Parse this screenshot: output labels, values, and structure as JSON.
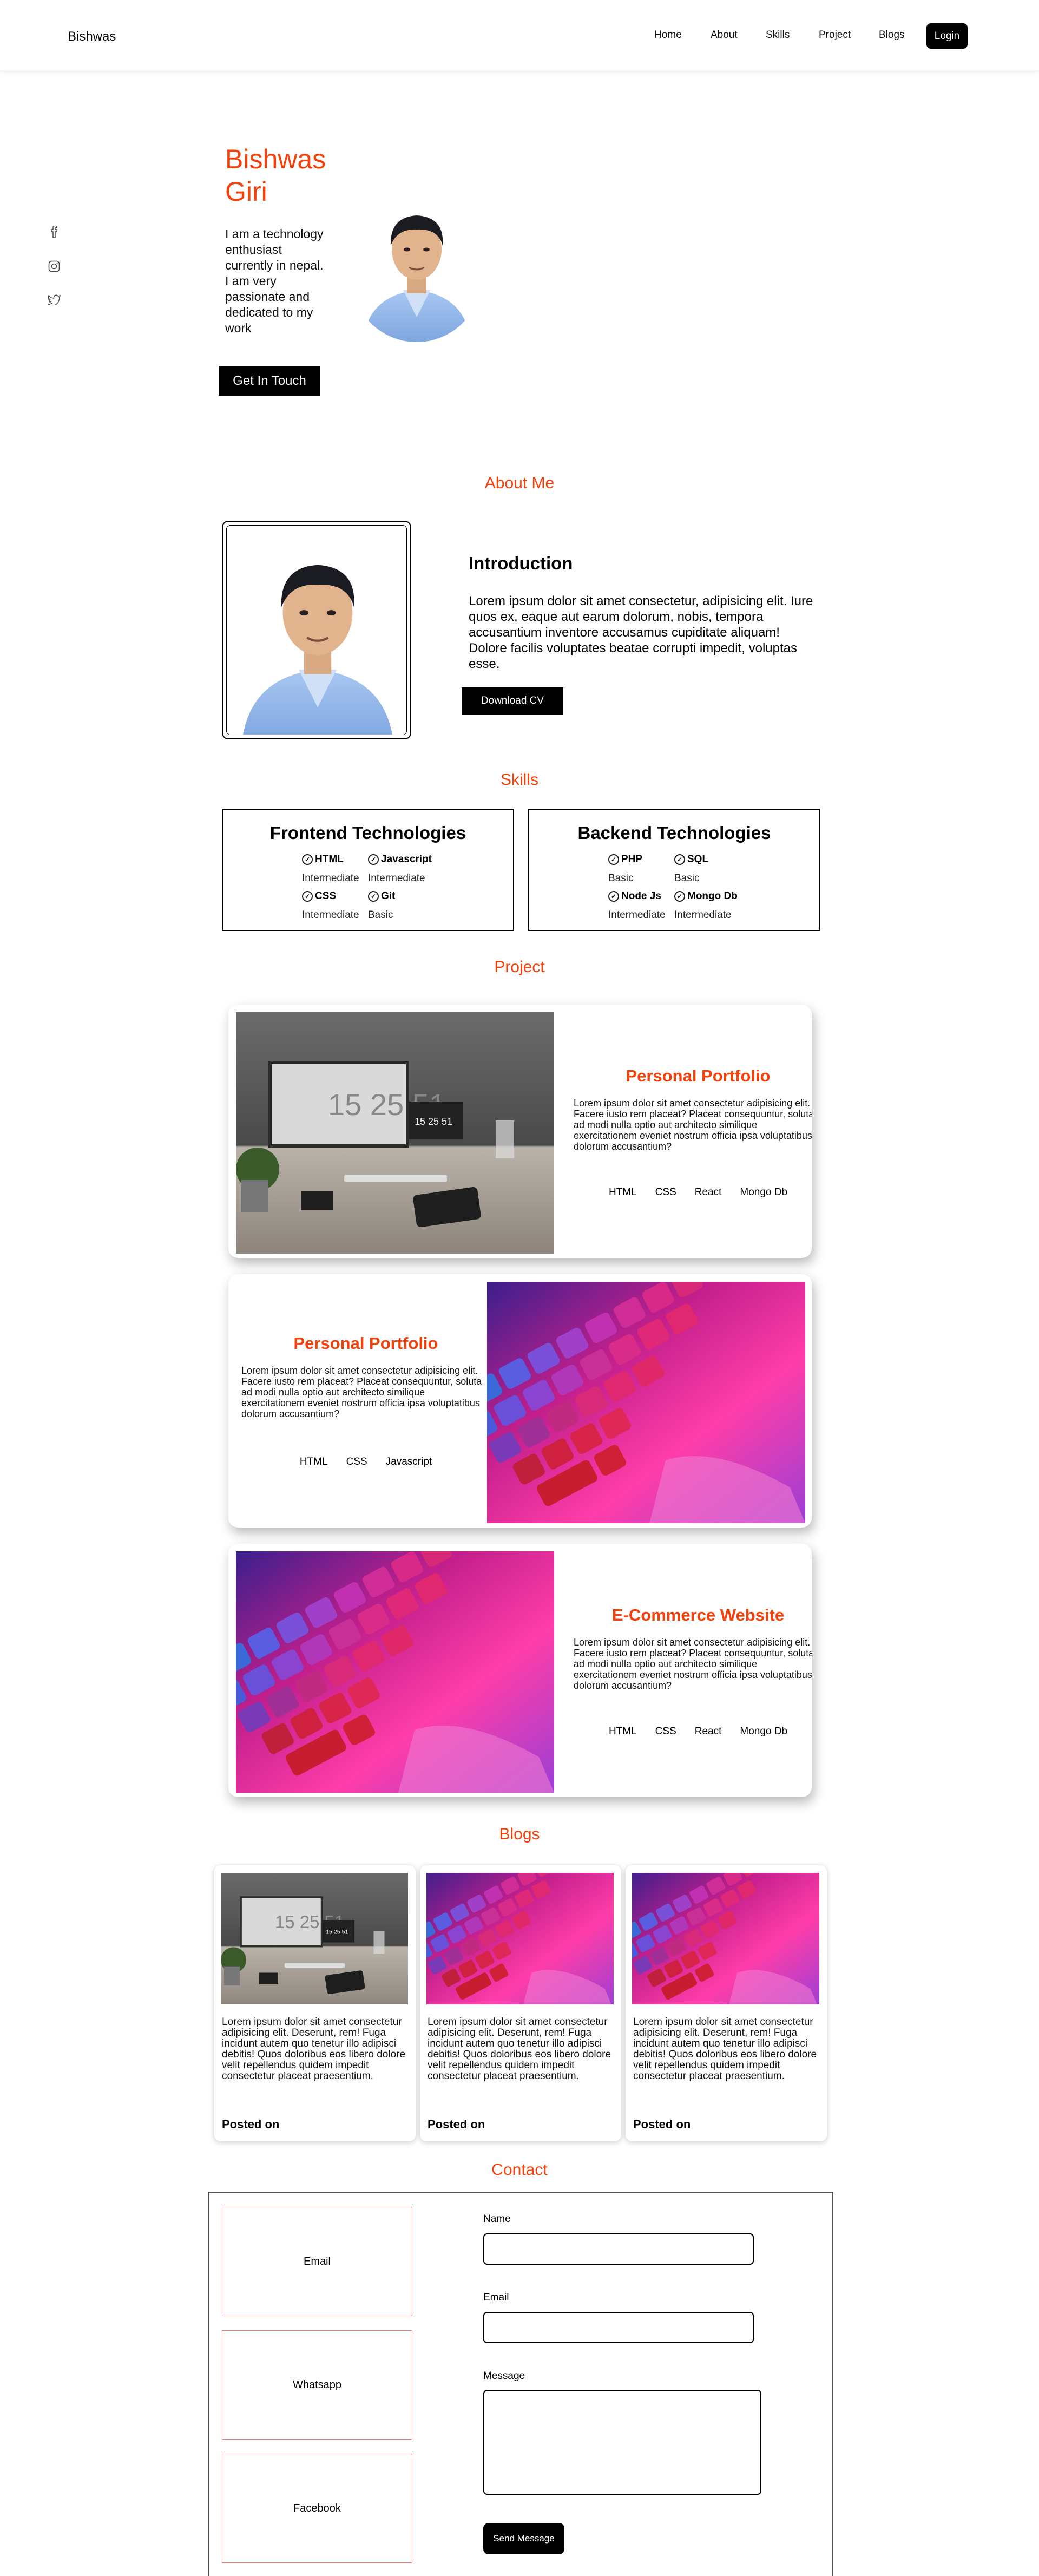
{
  "nav": {
    "brand": "Bishwas",
    "links": [
      "Home",
      "About",
      "Skills",
      "Project",
      "Blogs"
    ],
    "login": "Login"
  },
  "social": [
    "facebook-icon",
    "instagram-icon",
    "twitter-icon"
  ],
  "hero": {
    "name": "Bishwas Giri",
    "bio": "I am a technology enthusiast currently in nepal. I am very passionate and dedicated to my work",
    "button": "Get In Touch"
  },
  "about": {
    "title": "About Me",
    "heading": "Introduction",
    "text": "Lorem ipsum dolor sit amet consectetur, adipisicing elit. Iure quos ex, eaque aut earum dolorum, nobis, tempora accusantium inventore accusamus cupiditate aliquam! Dolore facilis voluptates beatae corrupti impedit, voluptas esse.",
    "button": "Download CV"
  },
  "skills": {
    "title": "Skills",
    "groups": [
      {
        "heading": "Frontend Technologies",
        "items": [
          {
            "name": "HTML",
            "level": "Intermediate"
          },
          {
            "name": "Javascript",
            "level": "Intermediate"
          },
          {
            "name": "CSS",
            "level": "Intermediate"
          },
          {
            "name": "Git",
            "level": "Basic"
          }
        ]
      },
      {
        "heading": "Backend Technologies",
        "items": [
          {
            "name": "PHP",
            "level": "Basic"
          },
          {
            "name": "SQL",
            "level": "Basic"
          },
          {
            "name": "Node Js",
            "level": "Intermediate"
          },
          {
            "name": "Mongo Db",
            "level": "Intermediate"
          }
        ]
      }
    ]
  },
  "projects": {
    "title": "Project",
    "items": [
      {
        "title": "Personal Portfolio",
        "desc": "Lorem ipsum dolor sit amet consectetur adipisicing elit. Facere iusto rem placeat? Placeat consequuntur, soluta ad modi nulla optio aut architecto similique exercitationem eveniet nostrum officia ipsa voluptatibus dolorum accusantium?",
        "tags": [
          "HTML",
          "CSS",
          "React",
          "Mongo Db"
        ]
      },
      {
        "title": "Personal Portfolio",
        "desc": "Lorem ipsum dolor sit amet consectetur adipisicing elit. Facere iusto rem placeat? Placeat consequuntur, soluta ad modi nulla optio aut architecto similique exercitationem eveniet nostrum officia ipsa voluptatibus dolorum accusantium?",
        "tags": [
          "HTML",
          "CSS",
          "Javascript"
        ]
      },
      {
        "title": "E-Commerce Website",
        "desc": "Lorem ipsum dolor sit amet consectetur adipisicing elit. Facere iusto rem placeat? Placeat consequuntur, soluta ad modi nulla optio aut architecto similique exercitationem eveniet nostrum officia ipsa voluptatibus dolorum accusantium?",
        "tags": [
          "HTML",
          "CSS",
          "React",
          "Mongo Db"
        ]
      }
    ]
  },
  "blogs": {
    "title": "Blogs",
    "items": [
      {
        "text": "Lorem ipsum dolor sit amet consectetur adipisicing elit. Deserunt, rem! Fuga incidunt autem quo tenetur illo adipisci debitis! Quos doloribus eos libero dolore velit repellendus quidem impedit consectetur placeat praesentium.",
        "posted": "Posted on"
      },
      {
        "text": "Lorem ipsum dolor sit amet consectetur adipisicing elit. Deserunt, rem! Fuga incidunt autem quo tenetur illo adipisci debitis! Quos doloribus eos libero dolore velit repellendus quidem impedit consectetur placeat praesentium.",
        "posted": "Posted on"
      },
      {
        "text": "Lorem ipsum dolor sit amet consectetur adipisicing elit. Deserunt, rem! Fuga incidunt autem quo tenetur illo adipisci debitis! Quos doloribus eos libero dolore velit repellendus quidem impedit consectetur placeat praesentium.",
        "posted": "Posted on"
      }
    ]
  },
  "contact": {
    "title": "Contact",
    "cards": [
      "Email",
      "Whatsapp",
      "Facebook"
    ],
    "name_label": "Name",
    "email_label": "Email",
    "message_label": "Message",
    "send": "Send Message"
  },
  "colors": {
    "accent": "#f2410a",
    "dark": "#000000",
    "contact_border": "#f08080"
  }
}
